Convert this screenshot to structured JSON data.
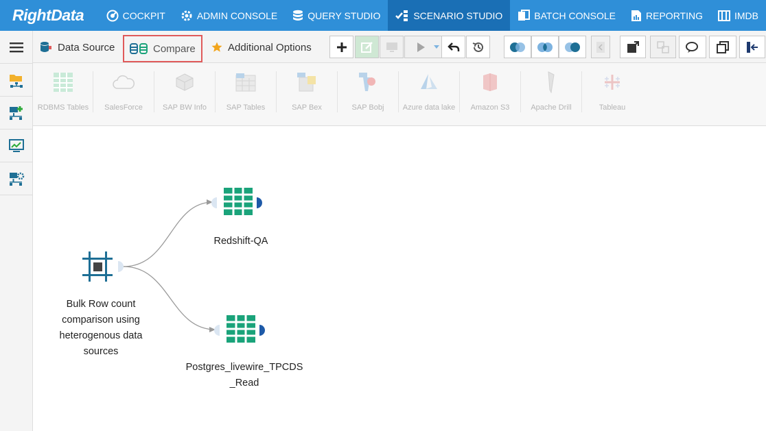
{
  "brand": {
    "name": "RightData"
  },
  "nav": [
    {
      "label": "COCKPIT",
      "icon": "cockpit-icon",
      "active": false
    },
    {
      "label": "ADMIN CONSOLE",
      "icon": "gear-icon",
      "active": false
    },
    {
      "label": "QUERY STUDIO",
      "icon": "database-icon",
      "active": false
    },
    {
      "label": "SCENARIO STUDIO",
      "icon": "scenario-icon",
      "active": true
    },
    {
      "label": "BATCH CONSOLE",
      "icon": "batch-icon",
      "active": false
    },
    {
      "label": "REPORTING",
      "icon": "report-icon",
      "active": false
    },
    {
      "label": "IMDB",
      "icon": "imdb-icon",
      "active": false
    }
  ],
  "tabs": {
    "data_source": "Data Source",
    "compare": "Compare",
    "additional": "Additional Options"
  },
  "ribbon": [
    "RDBMS Tables",
    "SalesForce",
    "SAP BW Info",
    "SAP Tables",
    "SAP Bex",
    "SAP Bobj",
    "Azure data lake",
    "Amazon S3",
    "Apache Drill",
    "Tableau"
  ],
  "nodes": {
    "source": {
      "label": "Bulk Row count comparison using heterogenous data sources"
    },
    "target1": {
      "label": "Redshift-QA"
    },
    "target2": {
      "label": "Postgres_livewire_TPCDS_Read"
    }
  },
  "colors": {
    "nav_bg": "#2f8fd8",
    "nav_active": "#1a6fb5",
    "table_node": "#1aa37a",
    "scenario_node": "#1e6f95",
    "highlight": "#e05a5a"
  }
}
